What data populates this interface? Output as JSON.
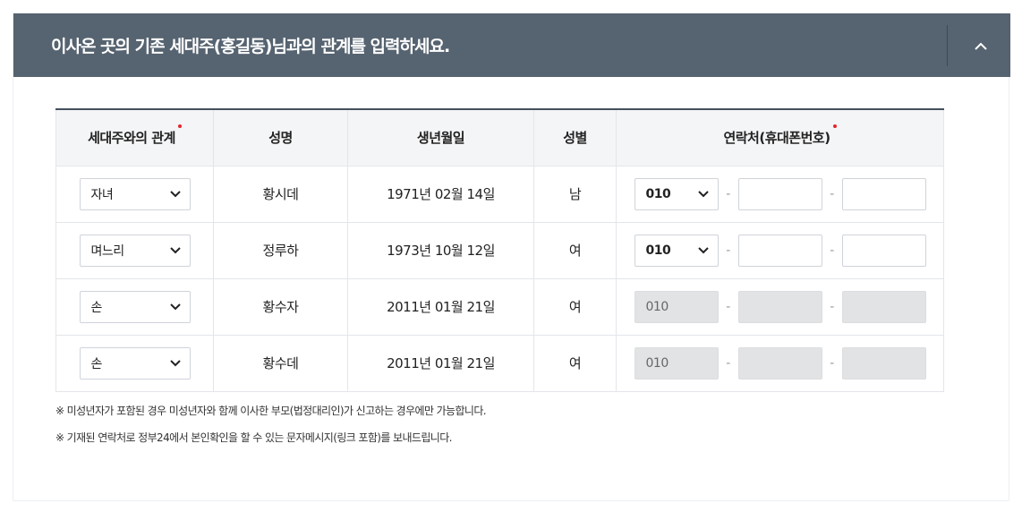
{
  "header": {
    "title": "이사온 곳의 기존 세대주(홍길동)님과의 관계를 입력하세요.",
    "toggle_icon": "chevron-up-icon"
  },
  "colors": {
    "header_bg": "#566370",
    "required_dot": "#e5252a",
    "table_top_border": "#44505c"
  },
  "table": {
    "headers": {
      "relation": "세대주와의 관계",
      "name": "성명",
      "birth": "생년월일",
      "gender": "성별",
      "contact": "연락처(휴대폰번호)"
    },
    "rows": [
      {
        "relation": "자녀",
        "name": "황시데",
        "birth": "1971년 02월 14일",
        "gender": "남",
        "phone_prefix": "010",
        "phone_mid": "",
        "phone_last": "",
        "phone_enabled": true
      },
      {
        "relation": "며느리",
        "name": "정루하",
        "birth": "1973년 10월 12일",
        "gender": "여",
        "phone_prefix": "010",
        "phone_mid": "",
        "phone_last": "",
        "phone_enabled": true
      },
      {
        "relation": "손",
        "name": "황수자",
        "birth": "2011년 01월 21일",
        "gender": "여",
        "phone_prefix": "010",
        "phone_mid": "",
        "phone_last": "",
        "phone_enabled": false
      },
      {
        "relation": "손",
        "name": "황수데",
        "birth": "2011년 01월 21일",
        "gender": "여",
        "phone_prefix": "010",
        "phone_mid": "",
        "phone_last": "",
        "phone_enabled": false
      }
    ],
    "phone_separator": "-"
  },
  "notes": [
    "※ 미성년자가 포함된 경우 미성년자와 함께 이사한 부모(법정대리인)가 신고하는 경우에만 가능합니다.",
    "※ 기재된 연락처로 정부24에서 본인확인을 할 수 있는 문자메시지(링크 포함)를 보내드립니다."
  ]
}
